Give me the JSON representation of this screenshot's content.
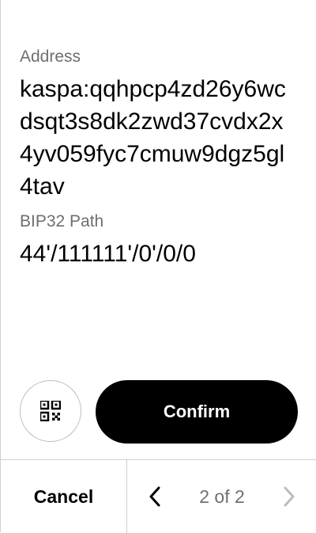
{
  "review": {
    "address_label": "Address",
    "address_value": "kaspa:qqhpcp4zd26y6wcdsqt3s8dk2zwd37cvdx2x4yv059fyc7cmuw9dgz5gl4tav",
    "path_label": "BIP32 Path",
    "path_value": "44'/111111'/0'/0/0"
  },
  "actions": {
    "qr_icon": "qr-code-icon",
    "confirm_label": "Confirm"
  },
  "footer": {
    "cancel_label": "Cancel",
    "page_indicator": "2 of 2",
    "prev_icon": "chevron-left-icon",
    "next_icon": "chevron-right-icon"
  },
  "colors": {
    "background": "#ffffff",
    "text_primary": "#000000",
    "label_gray": "#6e6e6e",
    "button_bg": "#000000",
    "button_text": "#ffffff",
    "divider": "#cfcfcf",
    "disabled_icon": "#bdbdbd"
  }
}
